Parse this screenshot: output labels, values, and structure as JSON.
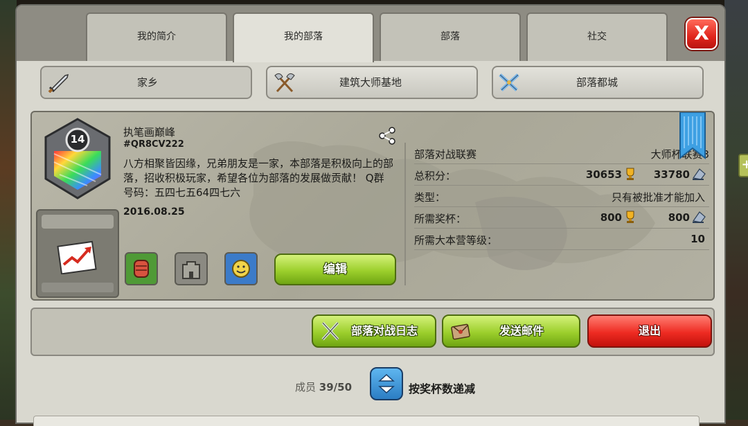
{
  "tabs": [
    {
      "label": "我的简介"
    },
    {
      "label": "我的部落"
    },
    {
      "label": "部落"
    },
    {
      "label": "社交"
    }
  ],
  "close_label": "X",
  "base_buttons": [
    {
      "label": "家乡",
      "icon": "sword-icon"
    },
    {
      "label": "建筑大师基地",
      "icon": "crossed-axes-icon"
    },
    {
      "label": "部落都城",
      "icon": "crossed-swords-icon"
    }
  ],
  "clan": {
    "level": "14",
    "name": "执笔画巅峰",
    "tag": "#QR8CV222",
    "description": "八方相聚皆因缘，兄弟朋友是一家，本部落是积极向上的部落，招收积极玩家，希望各位为部落的发展做贡献！ Q群号码：五四七五64四七六",
    "date": "2016.08.25",
    "edit_label": "编辑"
  },
  "stats": {
    "war_league_label": "部落对战联赛",
    "war_league_value": "大师杯联赛3",
    "total_points_label": "总积分：",
    "total_points_trophies": "30653",
    "total_points_builder": "33780",
    "type_label": "类型：",
    "type_value": "只有被批准才能加入",
    "required_trophies_label": "所需奖杯：",
    "required_trophies": "800",
    "required_builder_trophies": "800",
    "required_th_label": "所需大本营等级：",
    "required_th_value": "10"
  },
  "actions": {
    "war_log": "部落对战日志",
    "send_mail": "发送邮件",
    "leave": "退出"
  },
  "members": {
    "label": "成员",
    "count": "39/50",
    "sort_label": "按奖杯数递减"
  }
}
